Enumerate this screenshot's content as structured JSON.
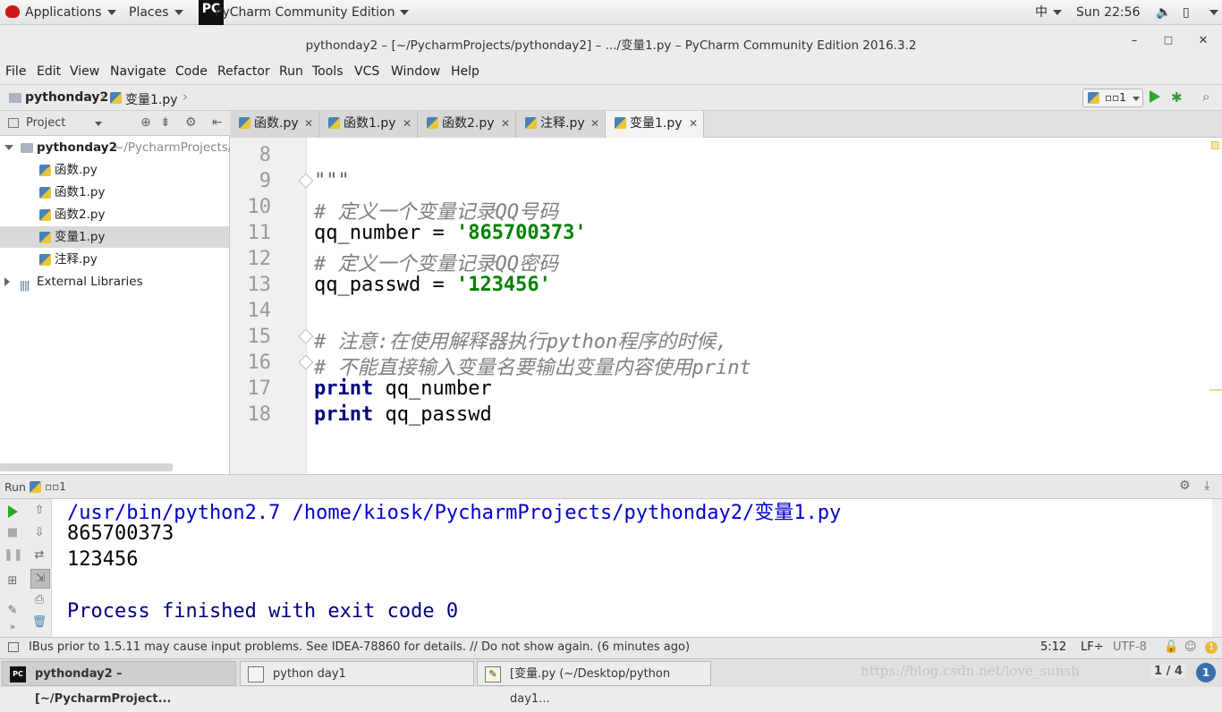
{
  "system_bar": {
    "applications": "Applications",
    "places": "Places",
    "active_app": "PyCharm Community Edition",
    "input_method": "中",
    "clock": "Sun 22:56"
  },
  "window": {
    "title": "pythonday2 – [~/PycharmProjects/pythonday2] – .../变量1.py – PyCharm Community Edition 2016.3.2",
    "minimize": "–",
    "maximize": "□",
    "close": "✕"
  },
  "menu": [
    "File",
    "Edit",
    "View",
    "Navigate",
    "Code",
    "Refactor",
    "Run",
    "Tools",
    "VCS",
    "Window",
    "Help"
  ],
  "navbar": {
    "crumb_project": "pythonday2",
    "crumb_file": "变量1.py",
    "run_config": "▫▫1"
  },
  "project_panel": {
    "header": "Project",
    "root_name": "pythonday2",
    "root_path": "~/PycharmProjects/",
    "files": [
      "函数.py",
      "函数1.py",
      "函数2.py",
      "变量1.py",
      "注释.py"
    ],
    "external": "External Libraries"
  },
  "tabs": [
    "函数.py",
    "函数1.py",
    "函数2.py",
    "注释.py",
    "变量1.py"
  ],
  "editor": {
    "line_numbers": [
      "8",
      "9",
      "10",
      "11",
      "12",
      "13",
      "14",
      "15",
      "16",
      "17",
      "18"
    ],
    "line9": "\"\"\"",
    "line10": "# 定义一个变量记录QQ号码",
    "line11_var": "qq_number = ",
    "line11_str": "'865700373'",
    "line12": "# 定义一个变量记录QQ密码",
    "line13_var": "qq_passwd = ",
    "line13_str": "'123456'",
    "line15": "# 注意:在使用解释器执行python程序的时候,",
    "line16": "# 不能直接输入变量名要输出变量内容使用print",
    "line17_kw": "print",
    "line17_arg": " qq_number",
    "line18_kw": "print",
    "line18_arg": " qq_passwd"
  },
  "run_panel": {
    "label": "Run",
    "config": "▫▫1",
    "output": [
      "/usr/bin/python2.7 /home/kiosk/PycharmProjects/pythonday2/变量1.py",
      "865700373",
      "123456",
      "",
      "Process finished with exit code 0"
    ]
  },
  "status": {
    "message": "IBus prior to 1.5.11 may cause input problems. See IDEA-78860 for details. // Do not show again. (6 minutes ago)",
    "position": "5:12",
    "line_sep": "LF÷",
    "encoding": "UTF-8",
    "notifications": "1"
  },
  "taskbar": {
    "tasks": [
      "pythonday2 – [~/PycharmProject...",
      "python day1",
      "[变量.py (~/Desktop/python day1..."
    ],
    "watermark": "https://blog.csdn.net/love_sunsh",
    "workspace": "1 / 4"
  },
  "colors": {
    "keyword": "#000080",
    "string": "#008000",
    "comment": "#808080",
    "console_path": "#0000cc",
    "console_finish": "#000080"
  }
}
